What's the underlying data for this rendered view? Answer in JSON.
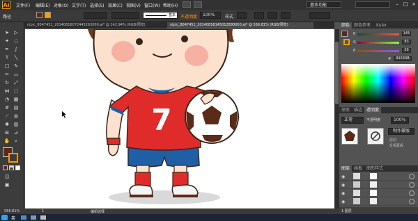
{
  "app": {
    "logo": "Ai"
  },
  "menu": {
    "items": [
      "文件(F)",
      "编辑(E)",
      "对象(O)",
      "文字(T)",
      "选择(S)",
      "效果(C)",
      "视图(V)",
      "窗口(W)",
      "帮助(H)"
    ]
  },
  "workspace": {
    "label": "基本功能"
  },
  "control_bar": {
    "selection_label": "路径",
    "stroke_style_label": "基本",
    "opacity_label": "不透明度",
    "opacity_value": "100%",
    "style_label": "样式"
  },
  "tabs": [
    {
      "label": "nipic_8047451_20140816072445263000.ai* @ 142.94% (RGB/预览)",
      "active": false
    },
    {
      "label": "nipic_8047451_20140816145012880000.ai* @ 566.81% (RGB/预览)",
      "active": true
    }
  ],
  "artwork": {
    "jersey_number": "7"
  },
  "status": {
    "zoom": "566.81%",
    "page": "1",
    "mode": "编组选择"
  },
  "taskbar": {
    "ime_label": "英"
  },
  "color_panel": {
    "tabs": [
      "颜色",
      "颜色参考",
      "Kuler"
    ],
    "r": "145",
    "g": "83",
    "b": "59",
    "hex": "91533B"
  },
  "gradient_tabs": [
    "渐变",
    "描边",
    "透明度"
  ],
  "transparency_panel": {
    "blend_mode": "正常",
    "opacity_label": "不透明度",
    "opacity_value": "100%",
    "make_mask": "制作蒙版",
    "clip": "剪切",
    "invert": "反相蒙版"
  },
  "layers_panel": {
    "tabs": [
      "图层",
      "画板",
      "图形样式"
    ],
    "count": "1 图层"
  },
  "colors": {
    "fill": "#5a2b18",
    "accent": "#ff9a00",
    "jersey": "#e02b2b",
    "shorts": "#1f5fa6"
  }
}
